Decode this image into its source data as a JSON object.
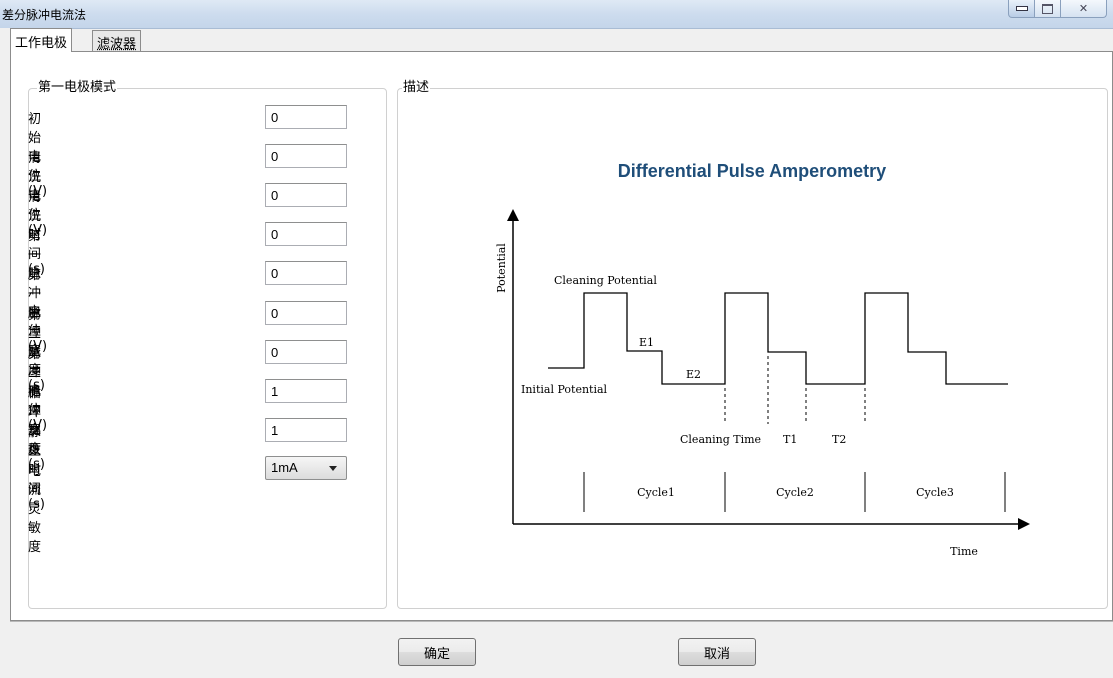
{
  "window": {
    "title": "差分脉冲电流法"
  },
  "tabs": [
    {
      "label": "工作电极"
    },
    {
      "label": "滤波器"
    }
  ],
  "left_group": {
    "title": "第一电极模式",
    "rows": [
      {
        "label": "初始电位(V)",
        "value": "0"
      },
      {
        "label": "清洗电位(V)",
        "value": "0"
      },
      {
        "label": "清洗时间(s)",
        "value": "0"
      },
      {
        "label": "第一脉冲电位(V)",
        "value": "0"
      },
      {
        "label": "第一脉冲宽度(s)",
        "value": "0"
      },
      {
        "label": "第二脉冲电位(V)",
        "value": "0"
      },
      {
        "label": "第二脉冲宽度(s)",
        "value": "0"
      },
      {
        "label": "循环次数",
        "value": "1"
      },
      {
        "label": "静止时间(s)",
        "value": "1"
      }
    ],
    "sensitivity": {
      "label": "电流灵敏度",
      "selected": "1mA"
    }
  },
  "description": {
    "title": "描述",
    "diagram": {
      "title": "Differential Pulse Amperometry",
      "y_axis_label": "Potential",
      "x_axis_label": "Time",
      "labels": {
        "cleaning_potential": "Cleaning Potential",
        "initial_potential": "Initial Potential",
        "e1": "E1",
        "e2": "E2",
        "cleaning_time": "Cleaning Time",
        "t1": "T1",
        "t2": "T2"
      },
      "cycles": [
        "Cycle1",
        "Cycle2",
        "Cycle3"
      ],
      "title_color": "#1f4e79"
    }
  },
  "buttons": {
    "ok": "确定",
    "cancel": "取消"
  }
}
